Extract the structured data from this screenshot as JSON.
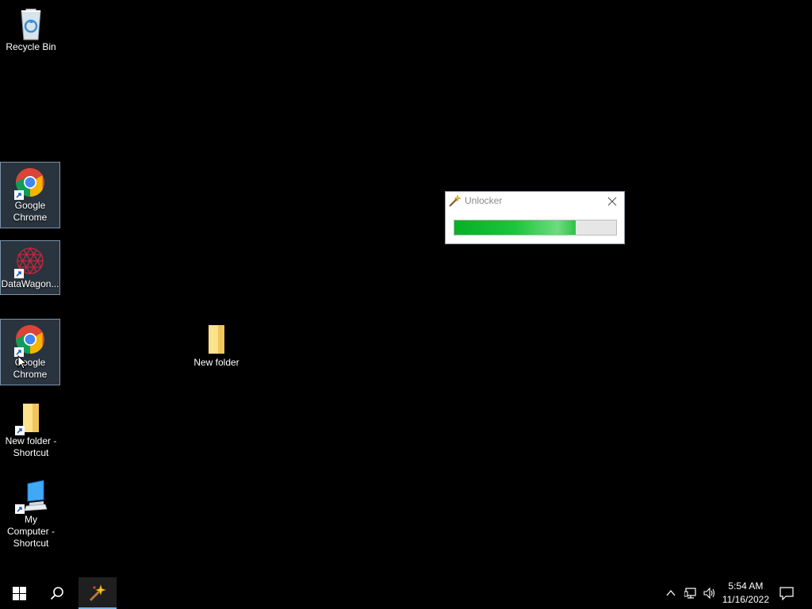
{
  "desktop": {
    "icons": [
      {
        "label": "Recycle Bin"
      },
      {
        "label": "Google Chrome"
      },
      {
        "label": "DataWagon..."
      },
      {
        "label": "Google Chrome"
      },
      {
        "label": "New folder - Shortcut"
      },
      {
        "label": "My Computer - Shortcut"
      },
      {
        "label": "New folder"
      }
    ]
  },
  "dialog": {
    "title": "Unlocker",
    "progress": 0.75,
    "close_icon": "close-icon"
  },
  "taskbar": {
    "time": "5:54 AM",
    "date": "11/16/2022",
    "icons": [
      "windows-start-icon",
      "search-icon",
      "unlocker-icon",
      "chevron-up-icon",
      "network-icon",
      "volume-icon",
      "notification-icon"
    ]
  },
  "colors": {
    "desktop_bg": "#000000",
    "progress_green": "#06b025",
    "taskbar_accent": "#76b9ed"
  }
}
